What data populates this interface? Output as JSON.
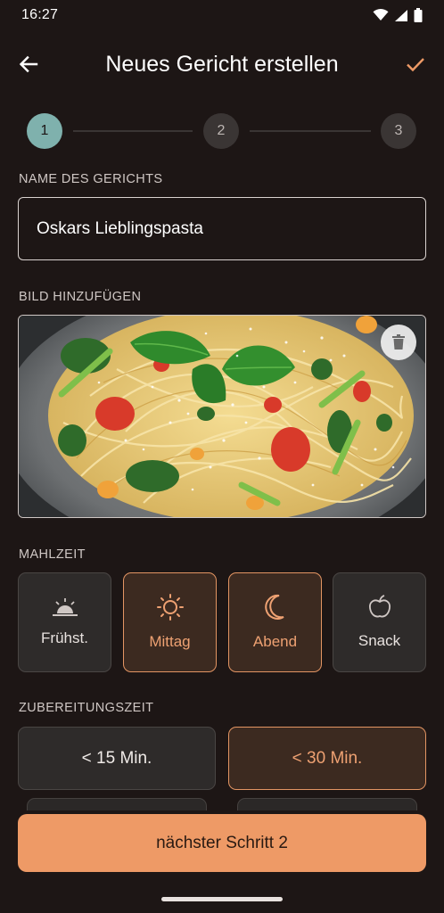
{
  "status": {
    "time": "16:27"
  },
  "app_bar": {
    "title": "Neues Gericht erstellen",
    "back_icon": "arrow-left-icon",
    "confirm_icon": "check-icon"
  },
  "stepper": {
    "steps": [
      "1",
      "2",
      "3"
    ],
    "active": 1
  },
  "name_section": {
    "label": "NAME DES GERICHTS",
    "value": "Oskars Lieblingspasta"
  },
  "image_section": {
    "label": "BILD HINZUFÜGEN",
    "delete_icon": "trash-icon"
  },
  "meal_section": {
    "label": "MAHLZEIT",
    "options": [
      {
        "label": "Frühst.",
        "icon": "sunrise-icon",
        "selected": false
      },
      {
        "label": "Mittag",
        "icon": "sun-icon",
        "selected": true
      },
      {
        "label": "Abend",
        "icon": "moon-icon",
        "selected": true
      },
      {
        "label": "Snack",
        "icon": "apple-icon",
        "selected": false
      }
    ]
  },
  "time_section": {
    "label": "ZUBEREITUNGSZEIT",
    "options": [
      {
        "label": "< 15 Min.",
        "selected": false
      },
      {
        "label": "< 30 Min.",
        "selected": true
      }
    ]
  },
  "primary_button": {
    "label": "nächster Schritt 2"
  },
  "colors": {
    "accent": "#ee9a66",
    "step_active": "#7fb1ad",
    "background": "#1d1615"
  }
}
